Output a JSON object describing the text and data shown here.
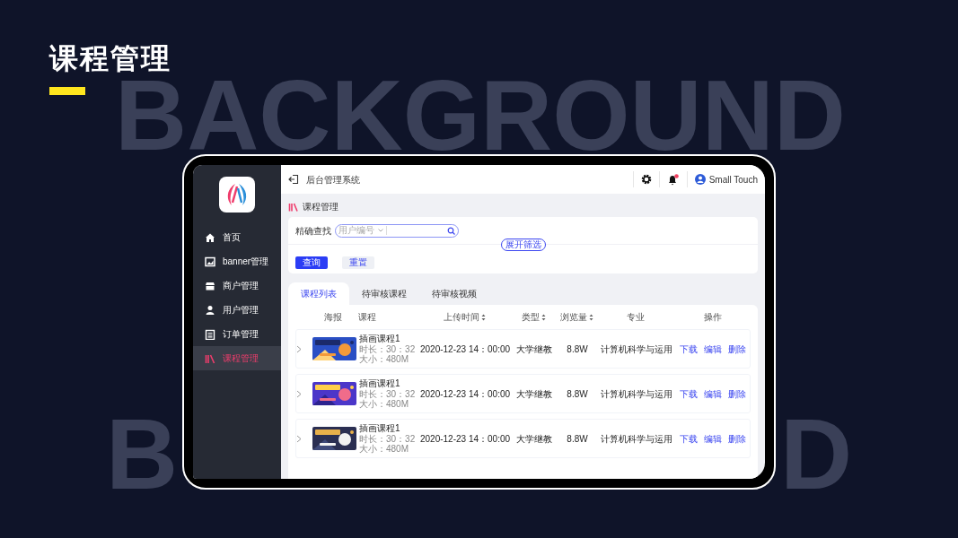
{
  "slide": {
    "title": "课程管理",
    "background_text_top": "BACKGROUND",
    "background_text_bottom_left": "B",
    "background_text_bottom_right": "D"
  },
  "app": {
    "header": {
      "title": "后台管理系统",
      "user": "Small Touch"
    },
    "sidebar": {
      "items": [
        {
          "label": "首页",
          "selected": false
        },
        {
          "label": "banner管理",
          "selected": false
        },
        {
          "label": "商户管理",
          "selected": false
        },
        {
          "label": "用户管理",
          "selected": false
        },
        {
          "label": "订单管理",
          "selected": false
        },
        {
          "label": "课程管理",
          "selected": true
        }
      ]
    },
    "page_title": "课程管理",
    "search": {
      "label": "精确查找",
      "field_select": "用户编号",
      "expand": "展开筛选",
      "buttons": [
        {
          "label": "查询",
          "kind": "primary"
        },
        {
          "label": "重置",
          "kind": "secondary"
        }
      ]
    },
    "tabs": [
      {
        "label": "课程列表",
        "selected": true
      },
      {
        "label": "待审核课程",
        "selected": false
      },
      {
        "label": "待审核视频",
        "selected": false
      }
    ],
    "table": {
      "columns": [
        {
          "label": "海报",
          "sortable": false
        },
        {
          "label": "课程",
          "sortable": false
        },
        {
          "label": "上传时间",
          "sortable": true
        },
        {
          "label": "类型",
          "sortable": true
        },
        {
          "label": "浏览量",
          "sortable": true
        },
        {
          "label": "专业",
          "sortable": false
        },
        {
          "label": "操作",
          "sortable": false
        }
      ],
      "rows": [
        {
          "name": "插画课程1",
          "duration": "时长：30：32",
          "size": "大小：480M",
          "time": "2020-12-23 14：00:00",
          "type": "大学继教",
          "views": "8.8W",
          "major": "计算机科学与运用",
          "actions": [
            "下载",
            "编辑",
            "删除"
          ]
        },
        {
          "name": "插画课程1",
          "duration": "时长：30：32",
          "size": "大小：480M",
          "time": "2020-12-23 14：00:00",
          "type": "大学继教",
          "views": "8.8W",
          "major": "计算机科学与运用",
          "actions": [
            "下载",
            "编辑",
            "删除"
          ]
        },
        {
          "name": "插画课程1",
          "duration": "时长：30：32",
          "size": "大小：480M",
          "time": "2020-12-23 14：00:00",
          "type": "大学继教",
          "views": "8.8W",
          "major": "计算机科学与运用",
          "actions": [
            "下载",
            "编辑",
            "删除"
          ]
        }
      ]
    }
  }
}
